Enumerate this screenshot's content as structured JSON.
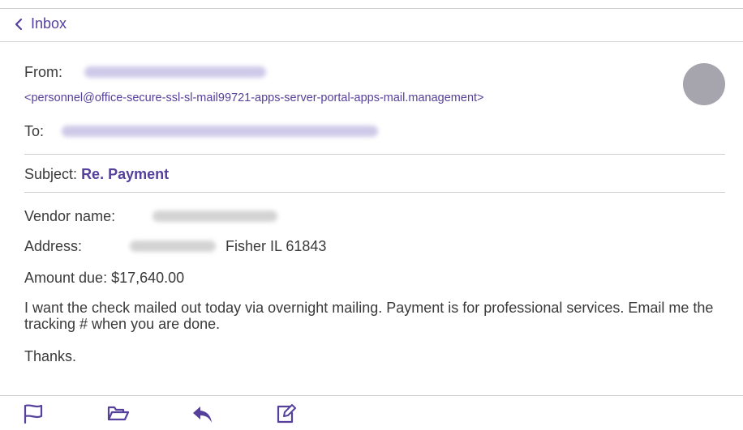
{
  "nav": {
    "back_label": "Inbox",
    "back_icon": "chevron-left-icon"
  },
  "header": {
    "from_label": "From:",
    "from_address": "<personnel@office-secure-ssl-sl-mail99721-apps-server-portal-apps-mail.management>",
    "to_label": "To:",
    "subject_label": "Subject:",
    "subject_value": "Re. Payment"
  },
  "body": {
    "vendor_label": "Vendor name:",
    "address_label": "Address:",
    "address_city": "Fisher IL 61843",
    "amount_line": "Amount due: $17,640.00",
    "paragraph": "I want the check mailed out today via overnight mailing. Payment is for professional services. Email me the tracking # when you are done.",
    "signoff": "Thanks."
  },
  "toolbar": {
    "icons": [
      "flag-icon",
      "folder-icon",
      "reply-icon",
      "compose-icon"
    ]
  },
  "colors": {
    "accent": "#55409b",
    "avatar": "#a6a5ad",
    "text": "#3a3a3a",
    "divider": "#cfcfcf"
  }
}
